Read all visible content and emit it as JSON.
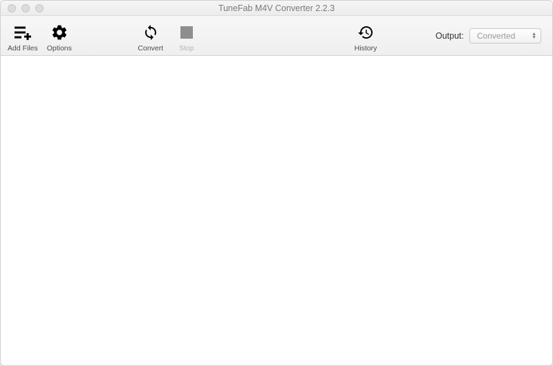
{
  "window": {
    "title": "TuneFab M4V Converter 2.2.3"
  },
  "toolbar": {
    "addFiles": "Add Files",
    "options": "Options",
    "convert": "Convert",
    "stop": "Stop",
    "history": "History",
    "outputLabel": "Output:",
    "outputDropdown": "Converted"
  }
}
